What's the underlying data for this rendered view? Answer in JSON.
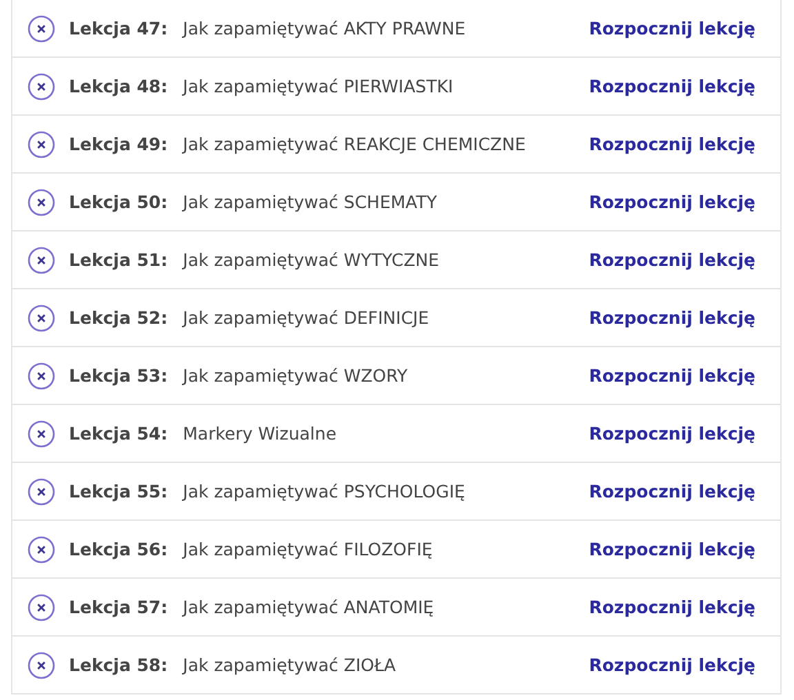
{
  "lessons": [
    {
      "label": "Lekcja 47:",
      "title": "Jak zapamiętywać AKTY PRAWNE",
      "action": "Rozpocznij lekcję"
    },
    {
      "label": "Lekcja 48:",
      "title": "Jak zapamiętywać PIERWIASTKI",
      "action": "Rozpocznij lekcję"
    },
    {
      "label": "Lekcja 49:",
      "title": "Jak zapamiętywać REAKCJE CHEMICZNE",
      "action": "Rozpocznij lekcję"
    },
    {
      "label": "Lekcja 50:",
      "title": "Jak zapamiętywać SCHEMATY",
      "action": "Rozpocznij lekcję"
    },
    {
      "label": "Lekcja 51:",
      "title": "Jak zapamiętywać WYTYCZNE",
      "action": "Rozpocznij lekcję"
    },
    {
      "label": "Lekcja 52:",
      "title": "Jak zapamiętywać DEFINICJE",
      "action": "Rozpocznij lekcję"
    },
    {
      "label": "Lekcja 53:",
      "title": "Jak zapamiętywać WZORY",
      "action": "Rozpocznij lekcję"
    },
    {
      "label": "Lekcja 54:",
      "title": "Markery Wizualne",
      "action": "Rozpocznij lekcję"
    },
    {
      "label": "Lekcja 55:",
      "title": "Jak zapamiętywać PSYCHOLOGIĘ",
      "action": "Rozpocznij lekcję"
    },
    {
      "label": "Lekcja 56:",
      "title": "Jak zapamiętywać FILOZOFIĘ",
      "action": "Rozpocznij lekcję"
    },
    {
      "label": "Lekcja 57:",
      "title": "Jak zapamiętywać ANATOMIĘ",
      "action": "Rozpocznij lekcję"
    },
    {
      "label": "Lekcja 58:",
      "title": "Jak zapamiętywać ZIOŁA",
      "action": "Rozpocznij lekcję"
    }
  ]
}
